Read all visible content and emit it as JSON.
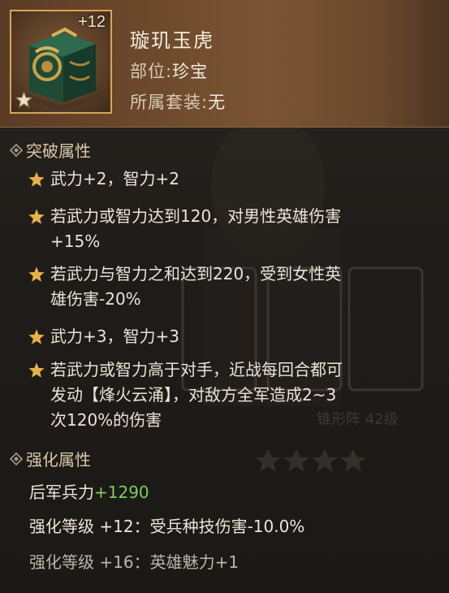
{
  "item": {
    "plus_level": "+12",
    "name": "璇玑玉虎",
    "slot_label": "部位:",
    "slot_value": "珍宝",
    "set_label": "所属套装:",
    "set_value": "无",
    "star_count": 5
  },
  "breakthrough": {
    "title": "突破属性",
    "entries": [
      {
        "line1": "武力+2，智力+2",
        "line2": ""
      },
      {
        "line1": "若武力或智力达到120，对男性英雄伤害",
        "line2": "+15%"
      },
      {
        "line1": "若武力与智力之和达到220，受到女性英",
        "line2": "雄伤害-20%"
      },
      {
        "line1": "武力+3，智力+3",
        "line2": ""
      },
      {
        "line1": "若武力或智力高于对手，近战每回合都可",
        "line2": "发动【烽火云涌】，对敌方全军造成2~3",
        "line3": "次120%的伤害"
      }
    ]
  },
  "enhance": {
    "title": "强化属性",
    "rear_troops_label": "后军兵力",
    "rear_troops_value": "+1290",
    "level12": "强化等级 +12：受兵种技伤害-10.0%",
    "level16": "强化等级 +16：英雄魅力+1"
  },
  "colors": {
    "gold_star": "#e6b04a",
    "green_value": "#7ccf5a",
    "frame_border": "#d9a45a"
  }
}
